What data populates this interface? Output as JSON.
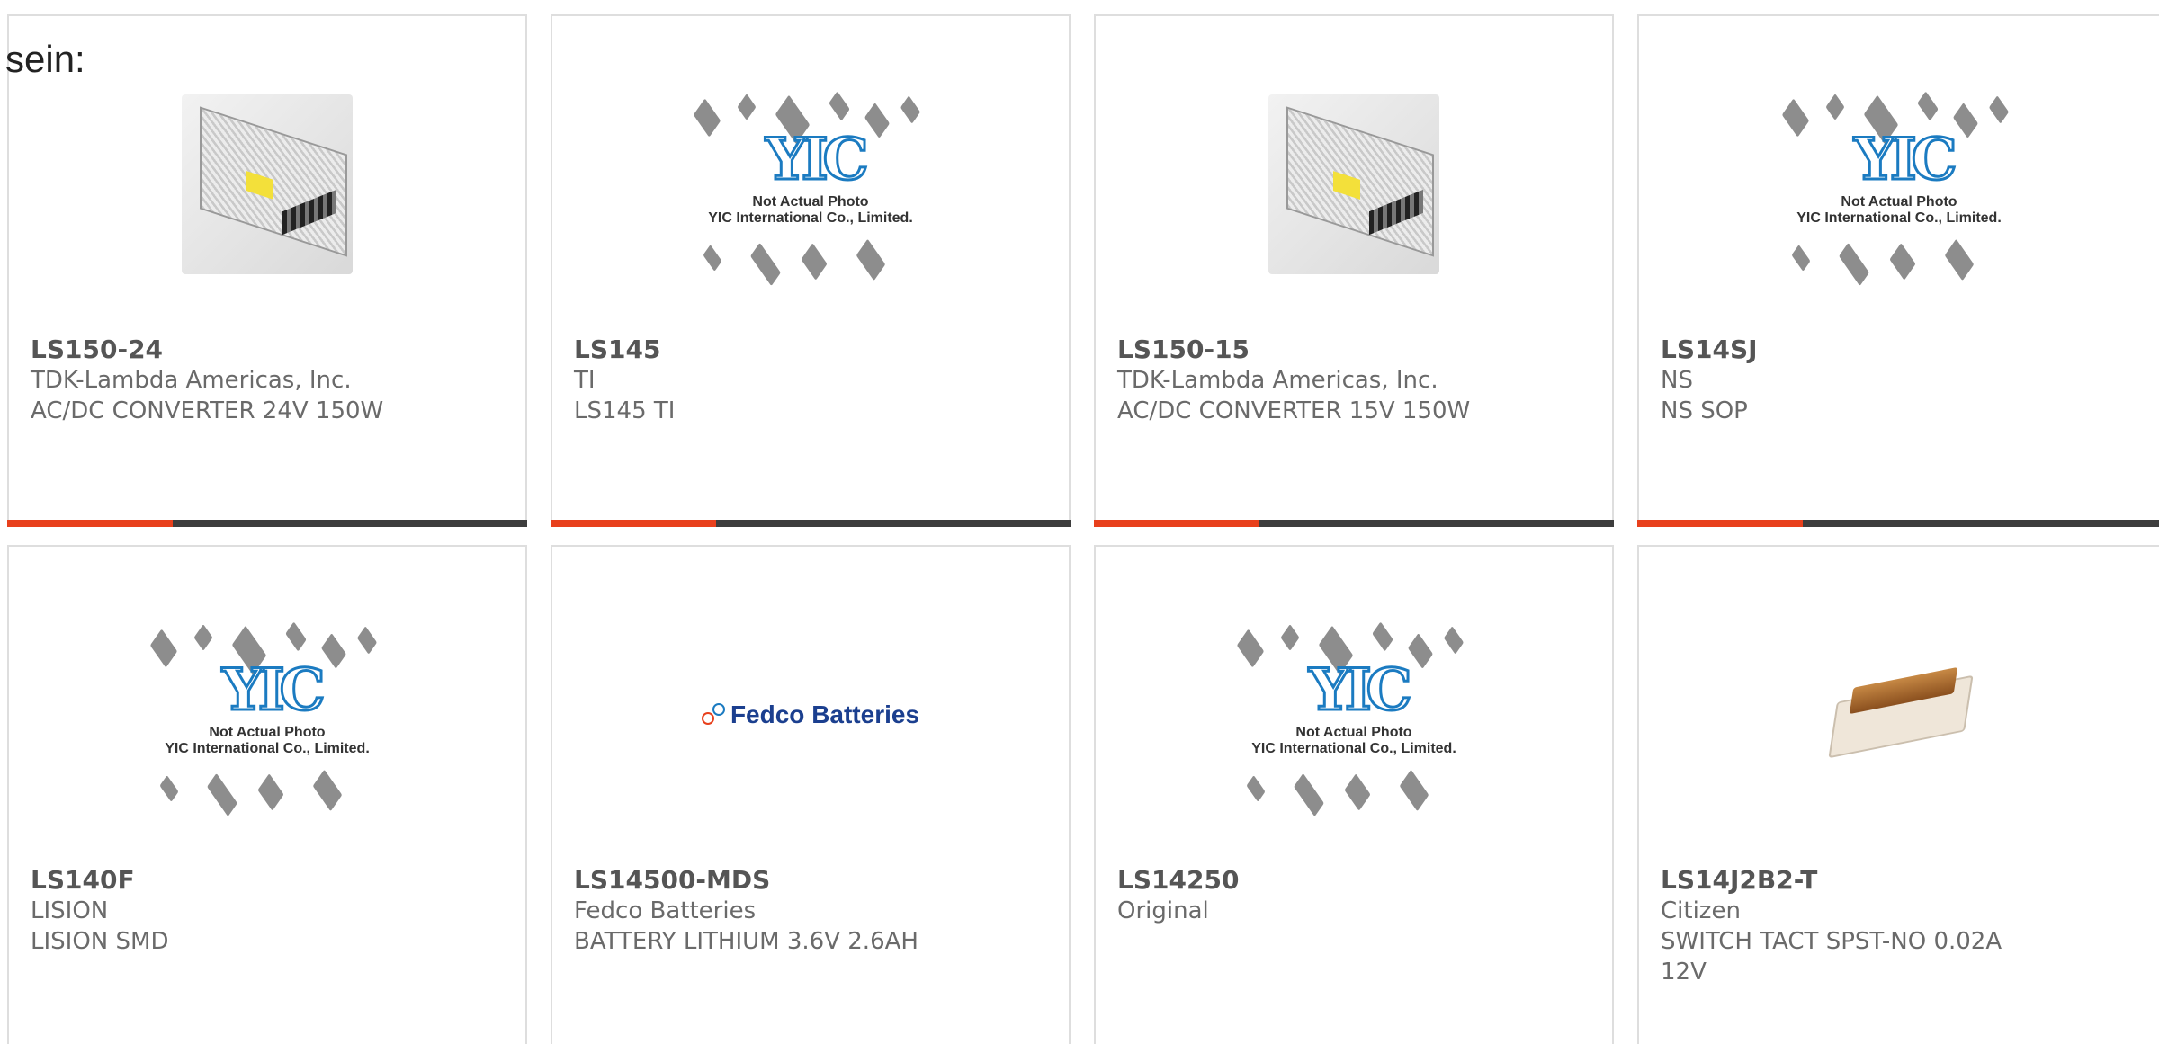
{
  "lead_text": "sein:",
  "colors": {
    "accent": "#e8401c",
    "bar": "#3d3d3d"
  },
  "placeholder_image": {
    "line1": "Not Actual Photo",
    "line2": "YIC International Co., Limited."
  },
  "products": [
    {
      "part": "LS150-24",
      "manufacturer": "TDK-Lambda Americas, Inc.",
      "description": "AC/DC CONVERTER 24V 150W",
      "image": "power-supply-photo"
    },
    {
      "part": "LS145",
      "manufacturer": "TI",
      "description": "LS145 TI",
      "image": "yic-placeholder"
    },
    {
      "part": "LS150-15",
      "manufacturer": "TDK-Lambda Americas, Inc.",
      "description": "AC/DC CONVERTER 15V 150W",
      "image": "power-supply-photo"
    },
    {
      "part": "LS14SJ",
      "manufacturer": "NS",
      "description": "NS SOP",
      "image": "yic-placeholder"
    },
    {
      "part": "LS140F",
      "manufacturer": "LISION",
      "description": "LISION SMD",
      "image": "yic-placeholder"
    },
    {
      "part": "LS14500-MDS",
      "manufacturer": "Fedco Batteries",
      "description": "BATTERY LITHIUM 3.6V 2.6AH",
      "image": "fedco-logo",
      "logo_text": "Fedco Batteries"
    },
    {
      "part": "LS14250",
      "manufacturer": "Original",
      "description": "",
      "image": "yic-placeholder"
    },
    {
      "part": "LS14J2B2-T",
      "manufacturer": "Citizen",
      "description": "SWITCH TACT SPST-NO 0.02A 12V",
      "image": "switch-photo"
    }
  ]
}
